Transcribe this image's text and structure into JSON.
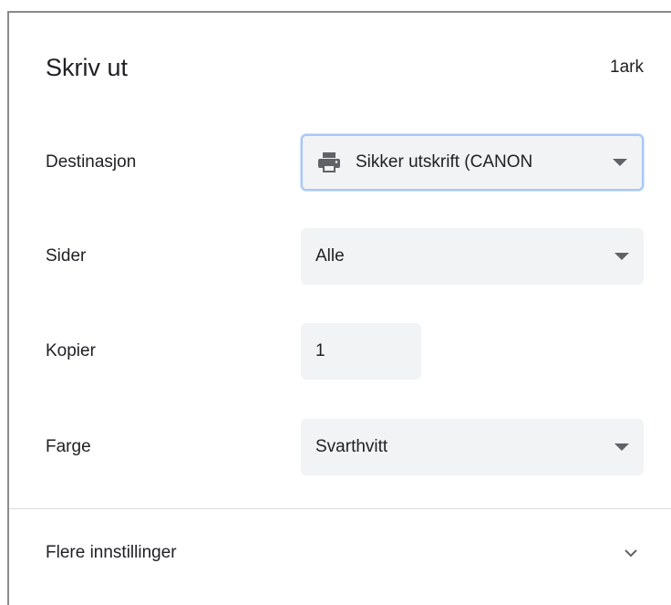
{
  "header": {
    "title": "Skriv ut",
    "sheet_count": "1ark"
  },
  "rows": {
    "destination": {
      "label": "Destinasjon",
      "value": "Sikker utskrift (CANON",
      "icon": "printer-icon"
    },
    "pages": {
      "label": "Sider",
      "value": "Alle"
    },
    "copies": {
      "label": "Kopier",
      "value": "1"
    },
    "color": {
      "label": "Farge",
      "value": "Svarthvitt"
    }
  },
  "more_settings": {
    "label": "Flere innstillinger",
    "icon": "chevron-down-icon"
  },
  "colors": {
    "control_bg": "#f1f3f4",
    "focus_border": "#a8c7fa",
    "text": "#202124",
    "icon": "#5f6368"
  }
}
